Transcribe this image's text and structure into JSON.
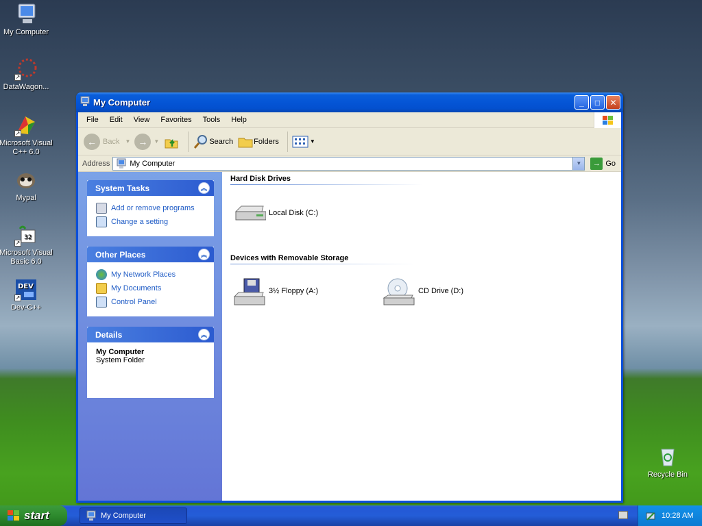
{
  "desktop": {
    "icons": [
      {
        "label": "My Computer"
      },
      {
        "label": "DataWagon..."
      },
      {
        "label": "Microsoft Visual C++ 6.0"
      },
      {
        "label": "Mypal"
      },
      {
        "label": "Microsoft Visual Basic 6.0"
      },
      {
        "label": "Dev-C++"
      },
      {
        "label": "Recycle Bin"
      }
    ]
  },
  "window": {
    "title": "My Computer",
    "menu": [
      "File",
      "Edit",
      "View",
      "Favorites",
      "Tools",
      "Help"
    ],
    "toolbar": {
      "back": "Back",
      "search": "Search",
      "folders": "Folders"
    },
    "address": {
      "label": "Address",
      "value": "My Computer",
      "go": "Go"
    },
    "left": {
      "system_tasks": {
        "title": "System Tasks",
        "items": [
          "Add or remove programs",
          "Change a setting"
        ]
      },
      "other_places": {
        "title": "Other Places",
        "items": [
          "My Network Places",
          "My Documents",
          "Control Panel"
        ]
      },
      "details": {
        "title": "Details",
        "name": "My Computer",
        "type": "System Folder"
      }
    },
    "groups": [
      {
        "title": "Hard Disk Drives",
        "items": [
          "Local Disk (C:)"
        ]
      },
      {
        "title": "Devices with Removable Storage",
        "items": [
          "3½ Floppy (A:)",
          "CD Drive (D:)"
        ]
      }
    ]
  },
  "taskbar": {
    "start": "start",
    "task": "My Computer",
    "clock": "10:28 AM"
  }
}
